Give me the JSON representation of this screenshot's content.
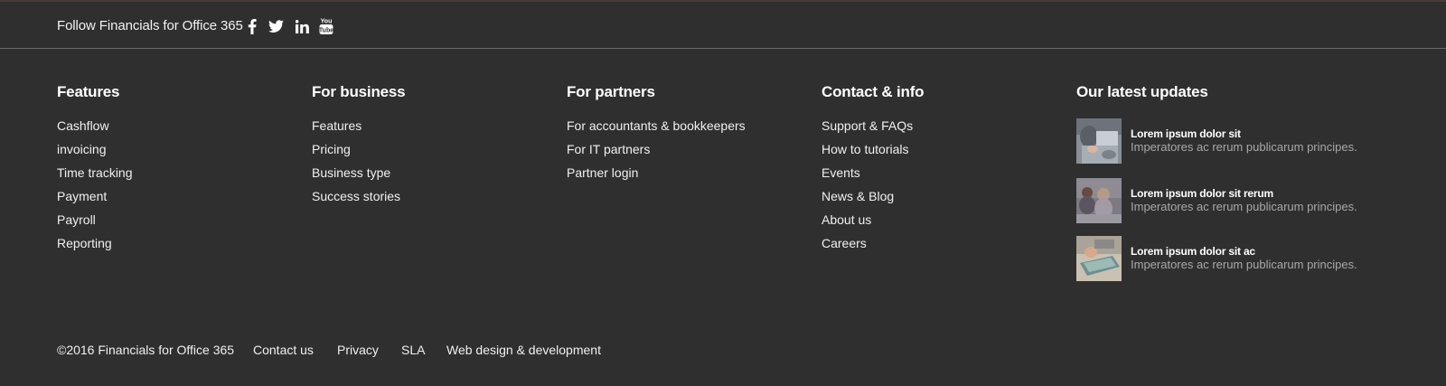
{
  "follow": {
    "text": "Follow Financials for Office 365",
    "social": [
      {
        "icon": "facebook-icon"
      },
      {
        "icon": "twitter-icon"
      },
      {
        "icon": "linkedin-icon"
      },
      {
        "icon": "youtube-icon",
        "label": "You Tube"
      }
    ]
  },
  "columns": {
    "features": {
      "title": "Features",
      "items": [
        "Cashflow",
        "invoicing",
        "Time tracking",
        "Payment",
        "Payroll",
        "Reporting"
      ]
    },
    "business": {
      "title": "For business",
      "items": [
        "Features",
        "Pricing",
        "Business type",
        "Success stories"
      ]
    },
    "partners": {
      "title": "For partners",
      "items": [
        "For accountants & bookkeepers",
        "For IT partners",
        "Partner login"
      ]
    },
    "contact": {
      "title": "Contact & info",
      "items": [
        "Support & FAQs",
        "How to tutorials",
        "Events",
        "News & Blog",
        "About us",
        "Careers"
      ]
    },
    "updates": {
      "title": "Our latest updates",
      "items": [
        {
          "title": "Lorem ipsum dolor sit",
          "desc": "Imperatores ac rerum publicarum principes."
        },
        {
          "title": "Lorem ipsum dolor sit rerum",
          "desc": "Imperatores ac rerum publicarum principes."
        },
        {
          "title": "Lorem ipsum dolor sit ac",
          "desc": "Imperatores ac rerum publicarum principes."
        }
      ]
    }
  },
  "bottom": {
    "copyright": "©2016 Financials for Office 365",
    "links": [
      "Contact us",
      "Privacy",
      "SLA",
      "Web design & development"
    ]
  },
  "colors": {
    "background": "#2f2f2f",
    "text": "#ffffff",
    "muted": "#a8a8a8",
    "divider": "#6a6a6a"
  }
}
